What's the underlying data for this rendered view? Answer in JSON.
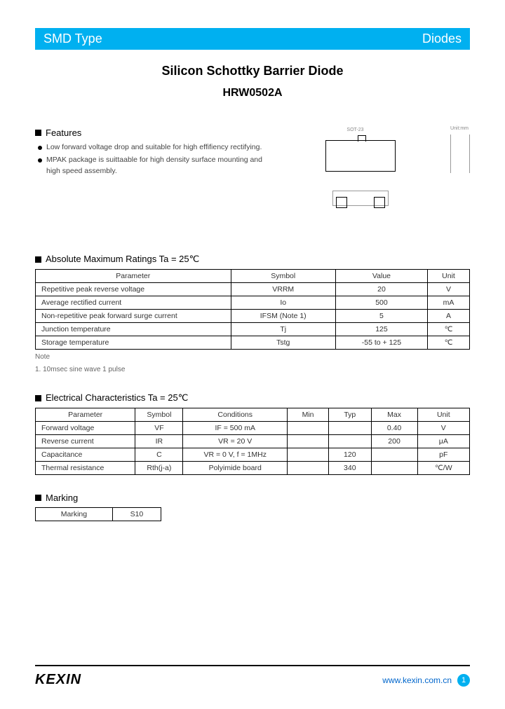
{
  "header": {
    "left": "SMD Type",
    "right": "Diodes"
  },
  "title": "Silicon Schottky Barrier Diode",
  "part_number": "HRW0502A",
  "package_label": "SOT-23",
  "features": {
    "heading": "Features",
    "items": [
      "Low forward voltage drop and suitable for high effifiency rectifying.",
      "MPAK package is suittaable for high density surface mounting and high speed assembly."
    ]
  },
  "abs_max": {
    "heading": "Absolute Maximum Ratings Ta = 25℃",
    "columns": [
      "Parameter",
      "Symbol",
      "Value",
      "Unit"
    ],
    "rows": [
      {
        "param": "Repetitive peak reverse voltage",
        "symbol": "VRRM",
        "value": "20",
        "unit": "V"
      },
      {
        "param": "Average rectified current",
        "symbol": "Io",
        "value": "500",
        "unit": "mA"
      },
      {
        "param": "Non-repetitive peak forward surge current",
        "symbol": "IFSM (Note 1)",
        "value": "5",
        "unit": "A"
      },
      {
        "param": "Junction temperature",
        "symbol": "Tj",
        "value": "125",
        "unit": "℃"
      },
      {
        "param": "Storage temperature",
        "symbol": "Tstg",
        "value": "-55 to + 125",
        "unit": "℃"
      }
    ],
    "note_label": "Note",
    "note_text": "1. 10msec sine wave 1 pulse"
  },
  "elec": {
    "heading": "Electrical Characteristics Ta = 25℃",
    "columns": [
      "Parameter",
      "Symbol",
      "Conditions",
      "Min",
      "Typ",
      "Max",
      "Unit"
    ],
    "rows": [
      {
        "param": "Forward voltage",
        "symbol": "VF",
        "cond": "IF = 500 mA",
        "min": "",
        "typ": "",
        "max": "0.40",
        "unit": "V"
      },
      {
        "param": "Reverse current",
        "symbol": "IR",
        "cond": "VR = 20 V",
        "min": "",
        "typ": "",
        "max": "200",
        "unit": "μA"
      },
      {
        "param": "Capacitance",
        "symbol": "C",
        "cond": "VR = 0 V, f = 1MHz",
        "min": "",
        "typ": "120",
        "max": "",
        "unit": "pF"
      },
      {
        "param": "Thermal resistance",
        "symbol": "Rth(j-a)",
        "cond": "Polyimide board",
        "min": "",
        "typ": "340",
        "max": "",
        "unit": "℃/W"
      }
    ]
  },
  "marking": {
    "heading": "Marking",
    "label": "Marking",
    "value": "S10"
  },
  "footer": {
    "logo": "KEXIN",
    "url": "www.kexin.com.cn",
    "page": "1"
  }
}
